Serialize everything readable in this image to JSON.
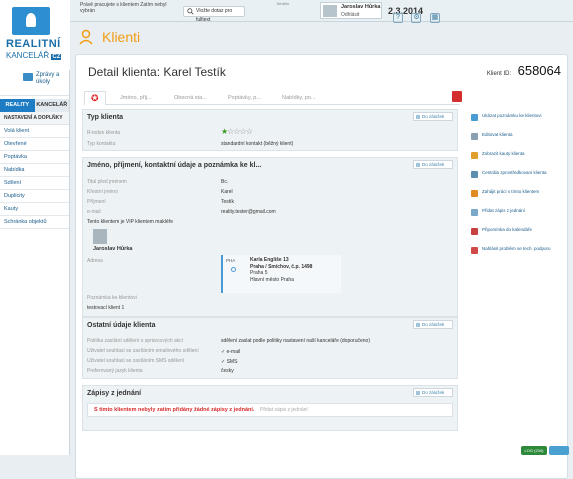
{
  "topbar": {
    "notice": "Právě pracujete s klientem Zatím nebyl vybrán",
    "search_label": "Vložte dotaz pro fulltext",
    "date_label": "Neděle",
    "date_value": "2.3.2014",
    "user_name": "Jaroslav Hůrka",
    "logout_label": "Odhlásit",
    "icons": [
      "question-icon",
      "settings-icon",
      "grid-icon"
    ]
  },
  "logo": {
    "line1": "REALITNÍ",
    "line2": "KANCELÁŘ",
    "suffix": "CZ"
  },
  "sidebar": {
    "news_label": "Zprávy a úkoly",
    "tabs": [
      {
        "label": "REALITY",
        "active": true
      },
      {
        "label": "KANCELÁŘ",
        "active": false
      }
    ],
    "section": "NASTAVENÍ A DOPLŇKY",
    "items": [
      {
        "label": "Volá klient"
      },
      {
        "label": "Otevřené"
      },
      {
        "label": "Poptávka"
      },
      {
        "label": "Nabídka"
      },
      {
        "label": "Sdílení"
      },
      {
        "label": "Duplicity"
      },
      {
        "label": "Kauty"
      },
      {
        "label": "Schránka objektů"
      }
    ]
  },
  "header": {
    "title": "Klienti"
  },
  "detail": {
    "title": "Detail klienta: Karel Testík",
    "client_id_label": "Klient ID:",
    "client_id": "658064",
    "tabs": [
      "",
      "Jméno, příj...",
      "Obecná sta...",
      "Poptávky, p...",
      "Nabídky, po..."
    ]
  },
  "edit_label": "Do záložek",
  "typ": {
    "heading": "Typ klienta",
    "rating_label": "R-index klienta",
    "rating": 1,
    "rating_max": 5,
    "contract_label": "Typ kontaktu",
    "contract_value": "standardní kontakt (běžný klient)"
  },
  "jmeno": {
    "heading": "Jméno, příjmení, kontaktní údaje a poznámka ke kl...",
    "fields": [
      {
        "label": "Titul před jménem",
        "value": "Bc."
      },
      {
        "label": "Křestní jméno",
        "value": "Karel"
      },
      {
        "label": "Příjmení",
        "value": "Testík"
      },
      {
        "label": "e-mail",
        "value": "reality.tester@gmail.com"
      }
    ],
    "vip_text": "Tento klientem je VIP klientem makléře",
    "vip_avatar_text": "Digitr",
    "vip_name": "Jaroslav Hůrka",
    "address_label": "Adresa",
    "address_tag": "PHA",
    "address_lines": [
      "Karla Engliše 13",
      "Praha / Smíchov, č.p. 1498",
      "Praha 5",
      "Hlavní město Praha"
    ],
    "note_label": "Poznámka ke klientovi",
    "note_value": "testovací klient 1"
  },
  "ostatni": {
    "heading": "Ostatní údaje klienta",
    "fields": [
      {
        "label": "Politika zasílání sdělení o správcových akcí",
        "value": "sdělení zaslat podle politiky nastavení naší kanceláře (doporučeno)"
      },
      {
        "label": "Uživatel souhlasí se zasíláním emailového sdělení",
        "value": "e-mail"
      },
      {
        "label": "Uživatel souhlasí se zasíláním SMS sdělení",
        "value": "SMS"
      },
      {
        "label": "Preferovaný jazyk klienta",
        "value": "česky"
      }
    ]
  },
  "zapisy": {
    "heading": "Zápisy z jednání",
    "warning": "S tímto klientem nebyly zatím přidány žádné zápisy z jednání.",
    "add_link": "Přidat zápis z jednání"
  },
  "actions": [
    {
      "label": "Ukázat poznámku ke klientovi",
      "icon": "note-icon",
      "color": "#4a9bd4"
    },
    {
      "label": "Editovat klienta",
      "icon": "pencil-icon",
      "color": "#8aa0b0"
    },
    {
      "label": "Zobrazit kauty klienta",
      "icon": "folder-icon",
      "color": "#e0a030"
    },
    {
      "label": "Centrála zprostředkovaní klienta",
      "icon": "people-icon",
      "color": "#5a8fb0"
    },
    {
      "label": "Zahájit práci s tímto klientem",
      "icon": "gear-icon",
      "color": "#e08a20"
    },
    {
      "label": "Přidat zápis z jednání",
      "icon": "doc-icon",
      "color": "#7aa8c8"
    },
    {
      "label": "Připomínka do kalendáře",
      "icon": "calendar-icon",
      "color": "#c84040"
    },
    {
      "label": "Nahlásit problém se tech. podporu",
      "icon": "alert-icon",
      "color": "#d04a4a"
    }
  ],
  "footer": {
    "badge_text": "LOG (234)"
  }
}
